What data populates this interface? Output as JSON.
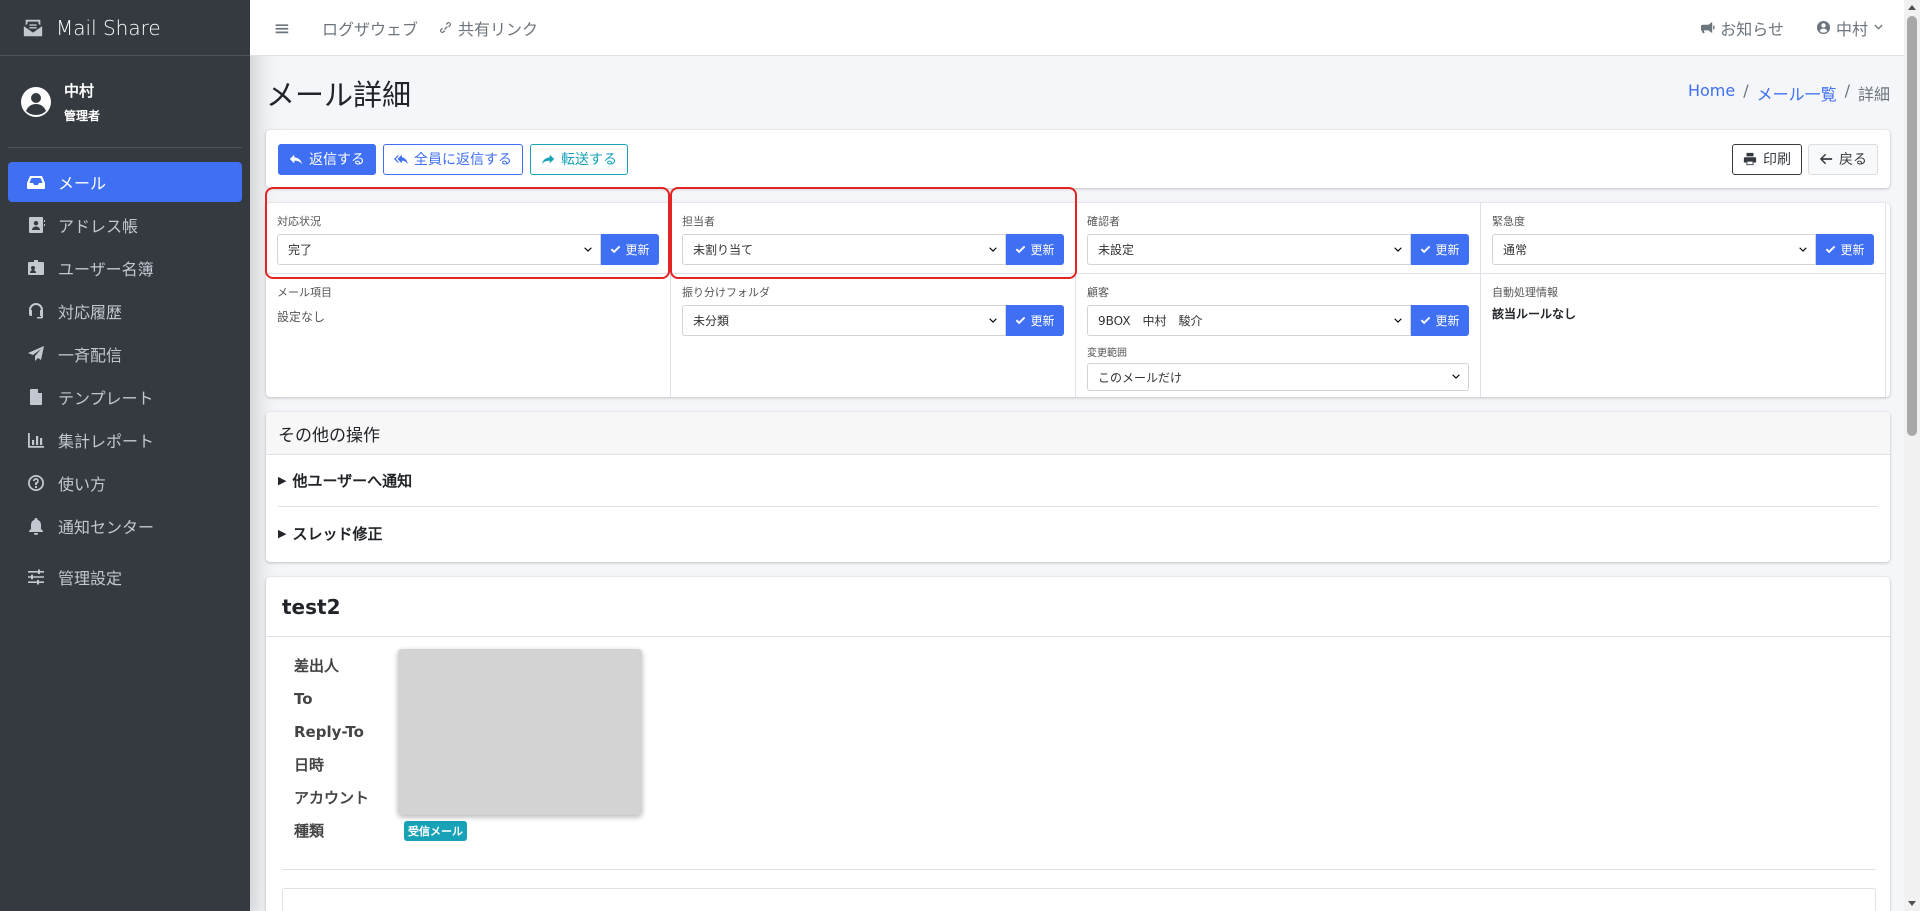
{
  "app": {
    "brand": "Mail Share"
  },
  "user_panel": {
    "name": "中村",
    "role": "管理者"
  },
  "sidebar": {
    "items": [
      {
        "label": "メール",
        "icon": "inbox-icon",
        "active": true
      },
      {
        "label": "アドレス帳",
        "icon": "address-book-icon"
      },
      {
        "label": "ユーザー名簿",
        "icon": "id-badge-icon"
      },
      {
        "label": "対応履歴",
        "icon": "headset-icon"
      },
      {
        "label": "一斉配信",
        "icon": "paper-plane-icon"
      },
      {
        "label": "テンプレート",
        "icon": "file-icon"
      },
      {
        "label": "集計レポート",
        "icon": "chart-bar-icon"
      },
      {
        "label": "使い方",
        "icon": "question-circle-icon"
      },
      {
        "label": "通知センター",
        "icon": "bell-icon"
      },
      {
        "label": "管理設定",
        "icon": "sliders-icon"
      }
    ]
  },
  "topbar": {
    "links": [
      "ログザウェブ",
      "共有リンク"
    ],
    "notice": "お知らせ",
    "user": "中村"
  },
  "page": {
    "title": "メール詳細",
    "breadcrumb": [
      "Home",
      "メール一覧",
      "詳細"
    ]
  },
  "actions": {
    "reply": "返信する",
    "reply_all": "全員に返信する",
    "forward": "転送する",
    "print": "印刷",
    "back": "戻る"
  },
  "props": {
    "update_label": "更新",
    "status": {
      "label": "対応状況",
      "value": "完了"
    },
    "assignee": {
      "label": "担当者",
      "value": "未割り当て"
    },
    "confirmer": {
      "label": "確認者",
      "value": "未設定"
    },
    "urgency": {
      "label": "緊急度",
      "value": "通常"
    },
    "mail_item": {
      "label": "メール項目",
      "value": "設定なし"
    },
    "folder": {
      "label": "振り分けフォルダ",
      "value": "未分類"
    },
    "customer": {
      "label": "顧客",
      "value": "9BOX　中村　駿介"
    },
    "scope": {
      "label": "変更範囲",
      "value": "このメールだけ"
    },
    "auto": {
      "label": "自動処理情報",
      "value": "該当ルールなし"
    }
  },
  "other_ops": {
    "title": "その他の操作",
    "notify": "他ユーザーへ通知",
    "thread": "スレッド修正"
  },
  "mail": {
    "subject": "test2",
    "fields": [
      "差出人",
      "To",
      "Reply-To",
      "日時",
      "アカウント",
      "種類"
    ],
    "type_badge": "受信メール"
  },
  "colors": {
    "primary": "#3f6ff2",
    "sidebar": "#343a40",
    "info": "#17a2b8",
    "highlight": "#e52323"
  }
}
